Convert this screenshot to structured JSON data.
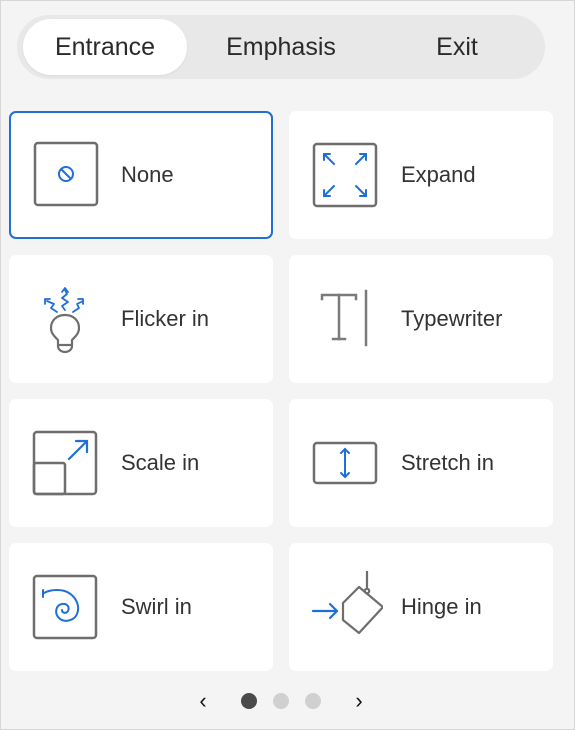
{
  "tabs": [
    {
      "label": "Entrance",
      "active": true
    },
    {
      "label": "Emphasis",
      "active": false
    },
    {
      "label": "Exit",
      "active": false
    }
  ],
  "animations": [
    {
      "label": "None",
      "icon": "none-icon",
      "selected": true
    },
    {
      "label": "Expand",
      "icon": "expand-icon",
      "selected": false
    },
    {
      "label": "Flicker in",
      "icon": "lightbulb-icon",
      "selected": false
    },
    {
      "label": "Typewriter",
      "icon": "text-cursor-icon",
      "selected": false
    },
    {
      "label": "Scale in",
      "icon": "scale-icon",
      "selected": false
    },
    {
      "label": "Stretch in",
      "icon": "stretch-icon",
      "selected": false
    },
    {
      "label": "Swirl in",
      "icon": "swirl-icon",
      "selected": false
    },
    {
      "label": "Hinge in",
      "icon": "hinge-icon",
      "selected": false
    }
  ],
  "pagination": {
    "current_page": 1,
    "total_pages": 3,
    "prev": "‹",
    "next": "›"
  },
  "colors": {
    "accent": "#1f6fd6",
    "icon_gray": "#6e6e6e",
    "background": "#f4f4f4",
    "card": "#ffffff"
  }
}
